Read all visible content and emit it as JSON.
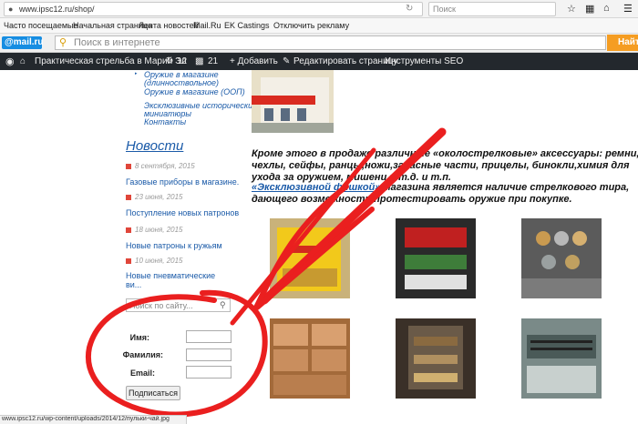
{
  "browser": {
    "url": "www.ipsc12.ru/shop/",
    "search_placeholder": "Поиск",
    "bookmarks": [
      "Часто посещаемые",
      "Начальная страница",
      "Лента новостей",
      "Mail.Ru",
      "EK Castings",
      "Отключить рекламу"
    ],
    "mail_logo": "@mail.ru",
    "mail_search_placeholder": "Поиск в интернете",
    "mail_find_button": "Найти"
  },
  "wpbar": {
    "site_name": "Практическая стрельба в Марий Эл",
    "updates": "12",
    "comments": "21",
    "add": "+ Добавить",
    "edit": "Редактировать страницу",
    "seo": "Инструменты SEO"
  },
  "sidebar": {
    "menu": [
      "Оружие в магазине",
      "(длинноствольное)",
      "Оружие в магазине (ООП)",
      "Эксклюзивные исторические",
      "миниатюры",
      "Контакты"
    ],
    "news_heading": "Новости",
    "news": [
      {
        "date": "8 сентября, 2015",
        "title": "Газовые приборы в магазине."
      },
      {
        "date": "23 июня, 2015",
        "title": "Поступление новых патронов"
      },
      {
        "date": "18 июня, 2015",
        "title": "Новые патроны к ружьям"
      },
      {
        "date": "10 июня, 2015",
        "title": "Новые пневматические"
      },
      {
        "date": "",
        "title": "ви..."
      }
    ],
    "search_placeholder": "Поиск по сайту...",
    "form": {
      "name_label": "Имя:",
      "surname_label": "Фамилия:",
      "email_label": "Email:",
      "subscribe": "Подписаться"
    }
  },
  "main": {
    "para1": [
      "Кроме этого в продаже различные «околострелковые» аксессуары: ремни,",
      "чехлы, сейфы, ранцы,ножи,запасные части, прицелы, бинокли,химия для",
      "ухода за оружием, мишени и т.д. и т.п."
    ],
    "para2_link": "«Эксклюзивной фишкой»",
    "para2_rest": " магазина является наличие стрелкового тира,",
    "para2_line2": "дающего возможность протестировать оружие при покупке."
  },
  "status_url": "www.ipsc12.ru/wp-content/uploads/2014/12/пульки-чай.jpg"
}
